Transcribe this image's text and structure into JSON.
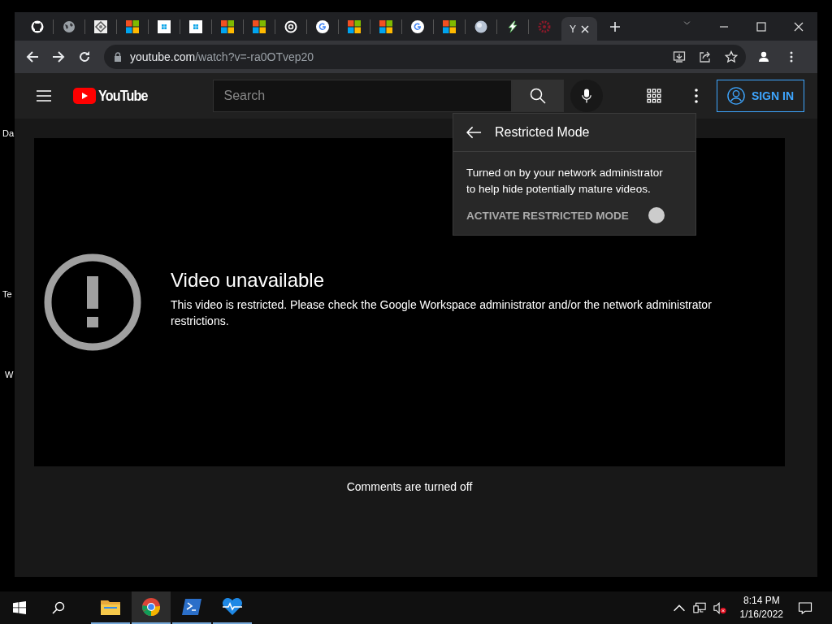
{
  "desktop": {
    "labels": [
      "Da",
      "Te",
      "W"
    ]
  },
  "browser": {
    "tabs": [
      {
        "kind": "github",
        "selected": false
      },
      {
        "kind": "globe",
        "selected": false
      },
      {
        "kind": "diamond",
        "selected": false
      },
      {
        "kind": "ms",
        "selected": false
      },
      {
        "kind": "win",
        "selected": false
      },
      {
        "kind": "win",
        "selected": false
      },
      {
        "kind": "ms",
        "selected": false
      },
      {
        "kind": "ms",
        "selected": false
      },
      {
        "kind": "chrome",
        "selected": false
      },
      {
        "kind": "google",
        "selected": false
      },
      {
        "kind": "ms",
        "selected": false
      },
      {
        "kind": "ms",
        "selected": false
      },
      {
        "kind": "google",
        "selected": false
      },
      {
        "kind": "ms",
        "selected": false
      },
      {
        "kind": "sphere",
        "selected": false
      },
      {
        "kind": "bolt",
        "selected": false
      },
      {
        "kind": "gear",
        "selected": false
      },
      {
        "kind": "text",
        "title": "Y",
        "selected": true
      }
    ],
    "address": {
      "domain": "youtube.com",
      "path": "/watch?v=-ra0OTvep20"
    }
  },
  "youtube": {
    "logo": "YouTube",
    "search": {
      "placeholder": "Search"
    },
    "sign_in": "SIGN IN",
    "menu": {
      "title": "Restricted Mode",
      "description": "Turned on by your network administrator to help hide potentially mature videos.",
      "toggle": {
        "label": "ACTIVATE RESTRICTED MODE",
        "on": false
      }
    },
    "video": {
      "title": "Video unavailable",
      "message": "This video is restricted. Please check the Google Workspace administrator and/or the network administrator restrictions."
    },
    "comments": "Comments are turned off"
  },
  "taskbar": {
    "apps": [
      {
        "kind": "folder",
        "selected": false
      },
      {
        "kind": "chrome",
        "selected": true
      },
      {
        "kind": "terminal",
        "selected": false
      },
      {
        "kind": "heart",
        "selected": false
      }
    ],
    "time": "8:14 PM",
    "date": "1/16/2022"
  }
}
